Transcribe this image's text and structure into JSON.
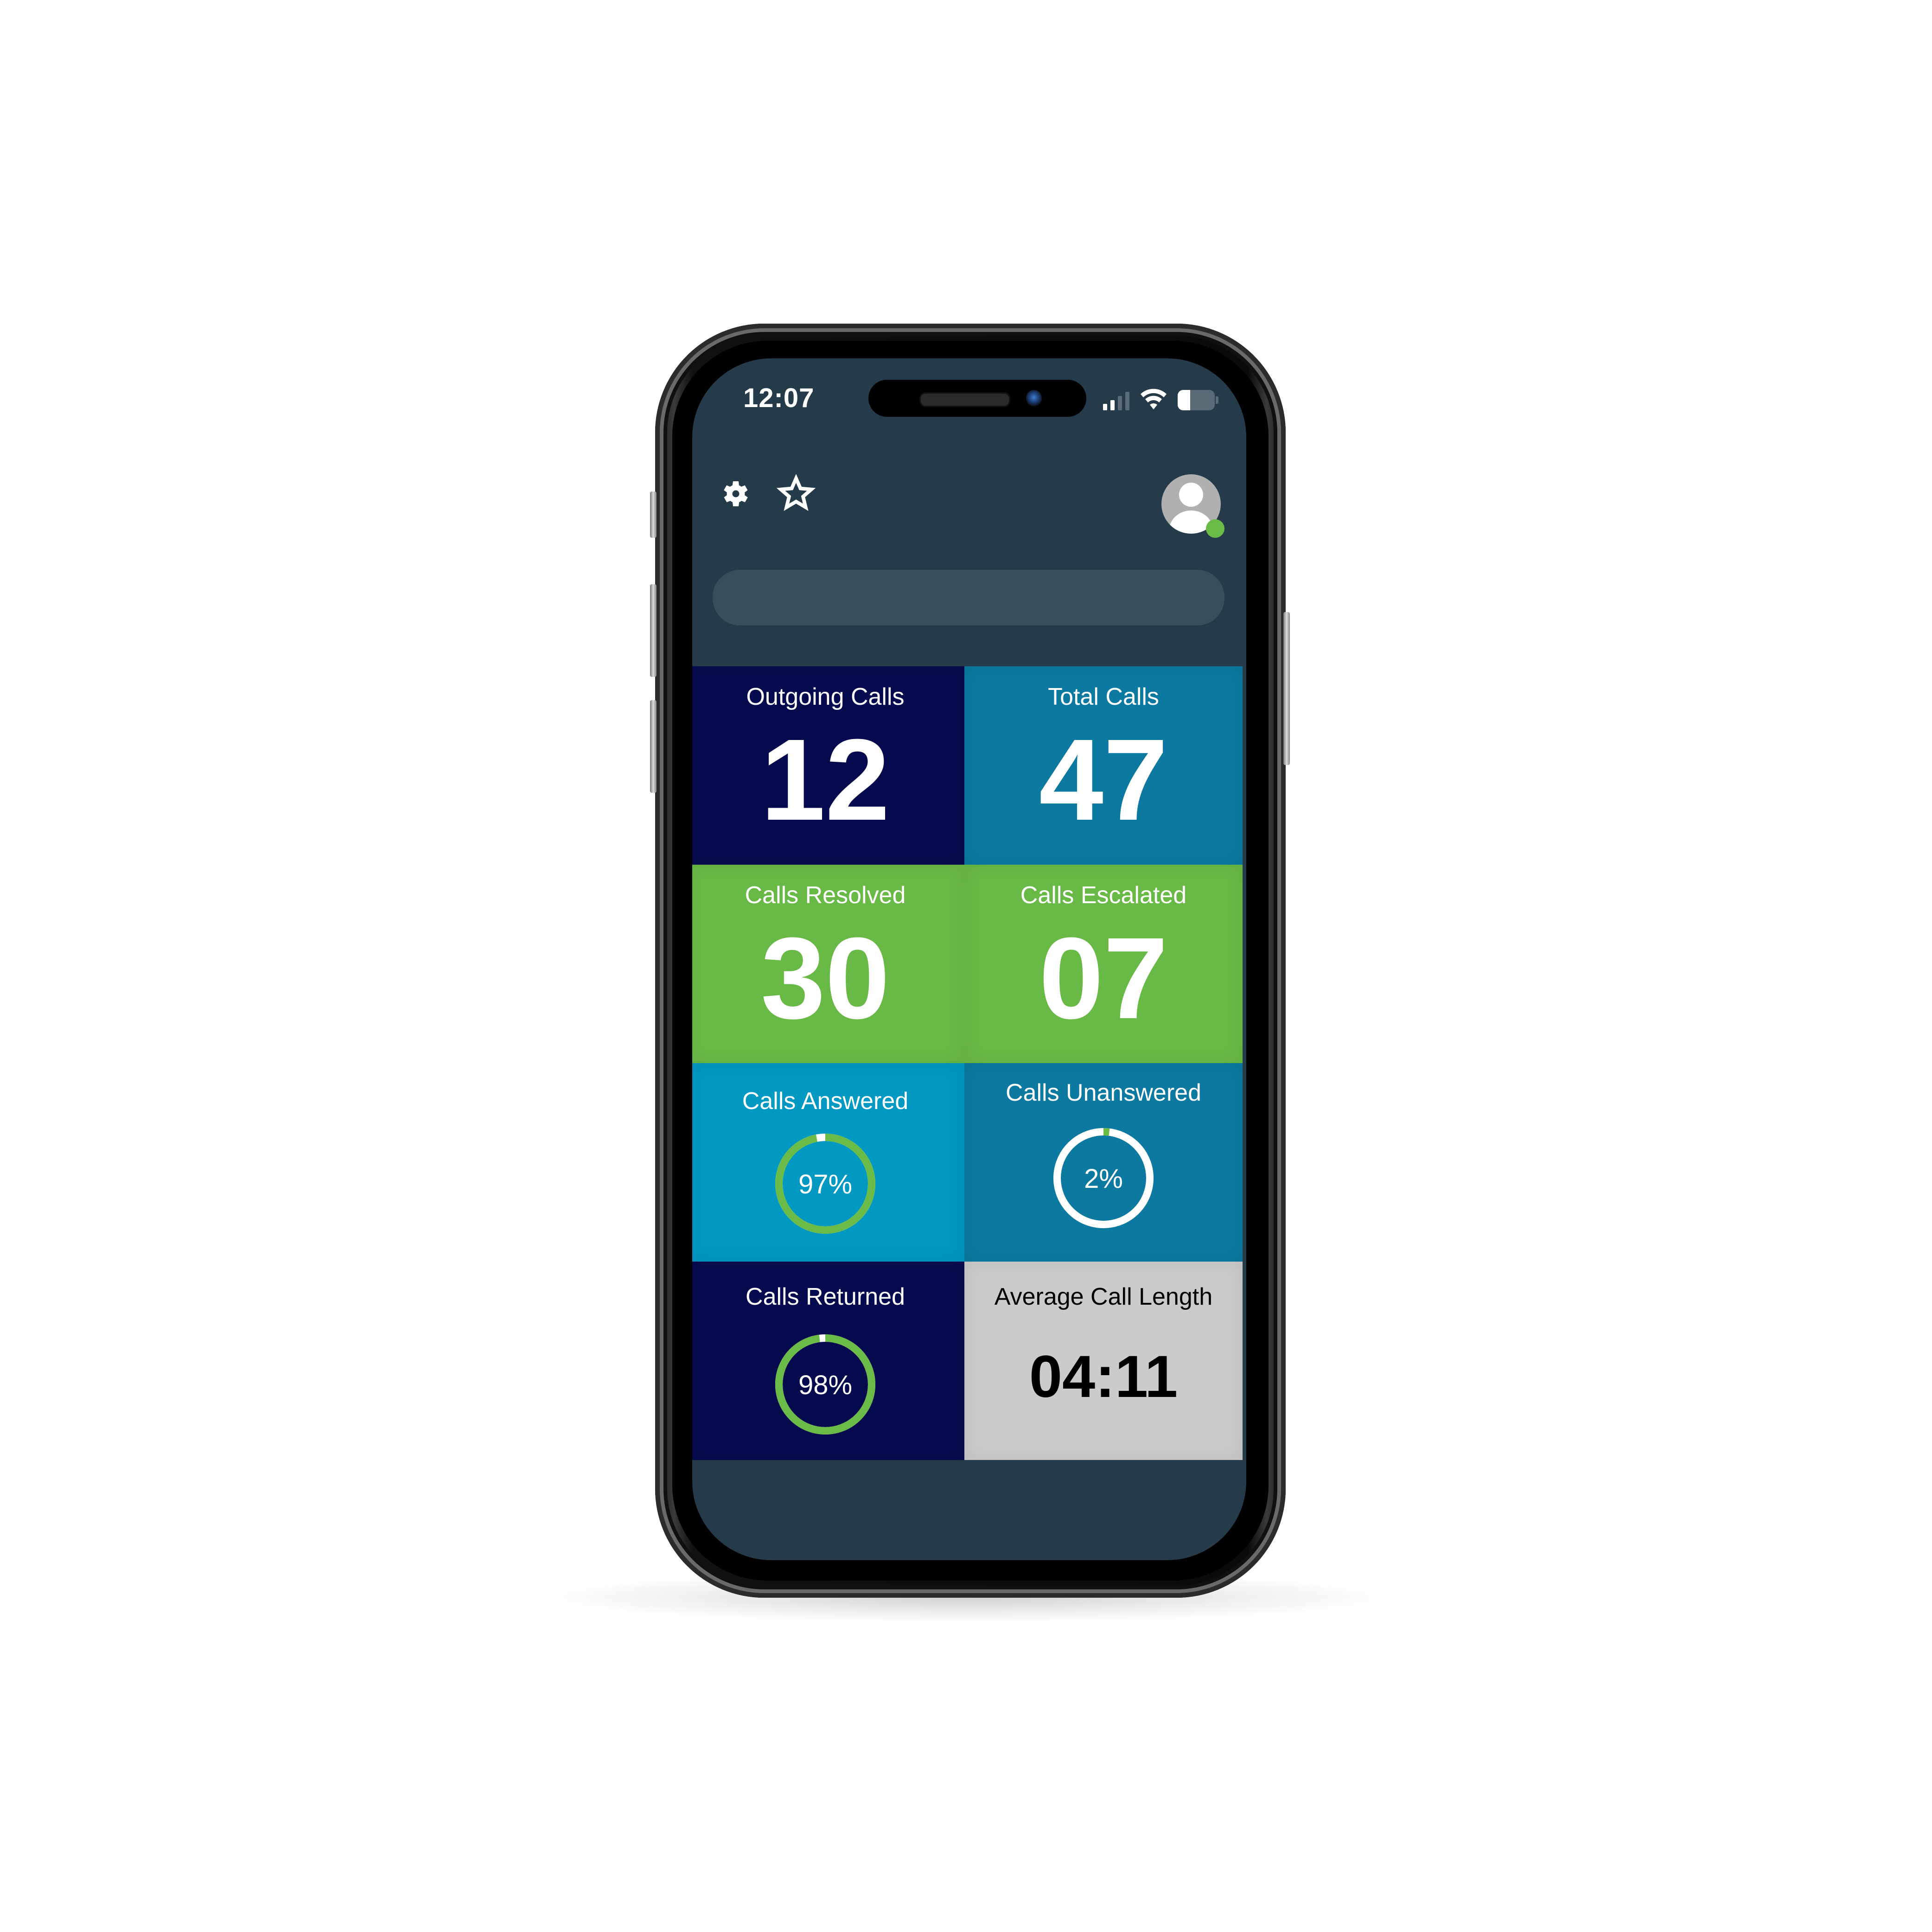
{
  "status_bar": {
    "time": "12:07",
    "signal_bars_active": 2,
    "signal_bars_total": 4,
    "battery_level": 0.35
  },
  "header": {
    "icons": [
      "gear-icon",
      "star-icon"
    ],
    "avatar": "user-avatar",
    "presence_status": "online",
    "search_placeholder": "",
    "search_value": ""
  },
  "colors": {
    "background": "#263b4a",
    "navy": "#050a4e",
    "teal": "#0b79a0",
    "green": "#69b946",
    "cyan": "#0198c2",
    "grey": "#cbcbcb",
    "ring_green": "#6abb47",
    "ring_white": "#ffffff"
  },
  "tiles": [
    {
      "label": "Outgoing Calls",
      "value": "12"
    },
    {
      "label": "Total Calls",
      "value": "47"
    },
    {
      "label": "Calls Resolved",
      "value": "30"
    },
    {
      "label": "Calls Escalated",
      "value": "07"
    },
    {
      "label": "Calls Answered",
      "value": "97%",
      "percent": 97,
      "ring_fill": "green"
    },
    {
      "label": "Calls Unanswered",
      "value": "2%",
      "percent": 2,
      "ring_fill": "green"
    },
    {
      "label": "Calls Returned",
      "value": "98%",
      "percent": 98,
      "ring_fill": "green"
    },
    {
      "label": "Average Call Length",
      "value": "04:11"
    }
  ]
}
